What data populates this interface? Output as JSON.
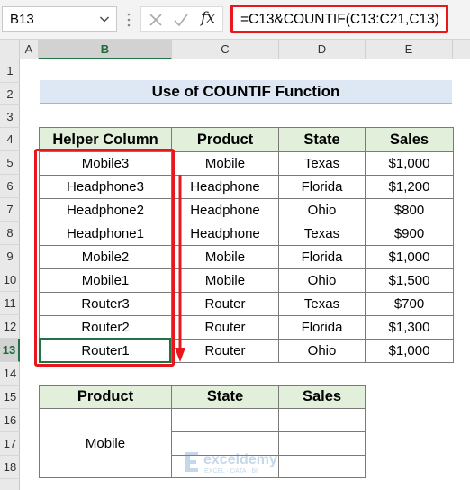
{
  "formula_bar": {
    "name_box": "B13",
    "formula": "=C13&COUNTIF(C13:C21,C13)",
    "fx": "fx"
  },
  "columns": [
    "A",
    "B",
    "C",
    "D",
    "E"
  ],
  "rows": [
    "1",
    "2",
    "3",
    "4",
    "5",
    "6",
    "7",
    "8",
    "9",
    "10",
    "11",
    "12",
    "13",
    "14",
    "15",
    "16",
    "17",
    "18"
  ],
  "selected_cell": {
    "column": "B",
    "row": "13"
  },
  "title": "Use of COUNTIF Function",
  "table1": {
    "headers": [
      "Helper Column",
      "Product",
      "State",
      "Sales"
    ],
    "rows": [
      [
        "Mobile3",
        "Mobile",
        "Texas",
        "$1,000"
      ],
      [
        "Headphone3",
        "Headphone",
        "Florida",
        "$1,200"
      ],
      [
        "Headphone2",
        "Headphone",
        "Ohio",
        "$800"
      ],
      [
        "Headphone1",
        "Headphone",
        "Texas",
        "$900"
      ],
      [
        "Mobile2",
        "Mobile",
        "Florida",
        "$1,000"
      ],
      [
        "Mobile1",
        "Mobile",
        "Ohio",
        "$1,500"
      ],
      [
        "Router3",
        "Router",
        "Texas",
        "$700"
      ],
      [
        "Router2",
        "Router",
        "Florida",
        "$1,300"
      ],
      [
        "Router1",
        "Router",
        "Ohio",
        "$1,000"
      ]
    ]
  },
  "table2": {
    "headers": [
      "Product",
      "State",
      "Sales"
    ],
    "product_value": "Mobile"
  },
  "watermark": {
    "name": "exceldemy",
    "tagline": "EXCEL · DATA · BI"
  },
  "colors": {
    "highlight_red": "#e8171e",
    "header_green": "#e2efda",
    "title_blue": "#dde8f4",
    "excel_green": "#217346"
  }
}
